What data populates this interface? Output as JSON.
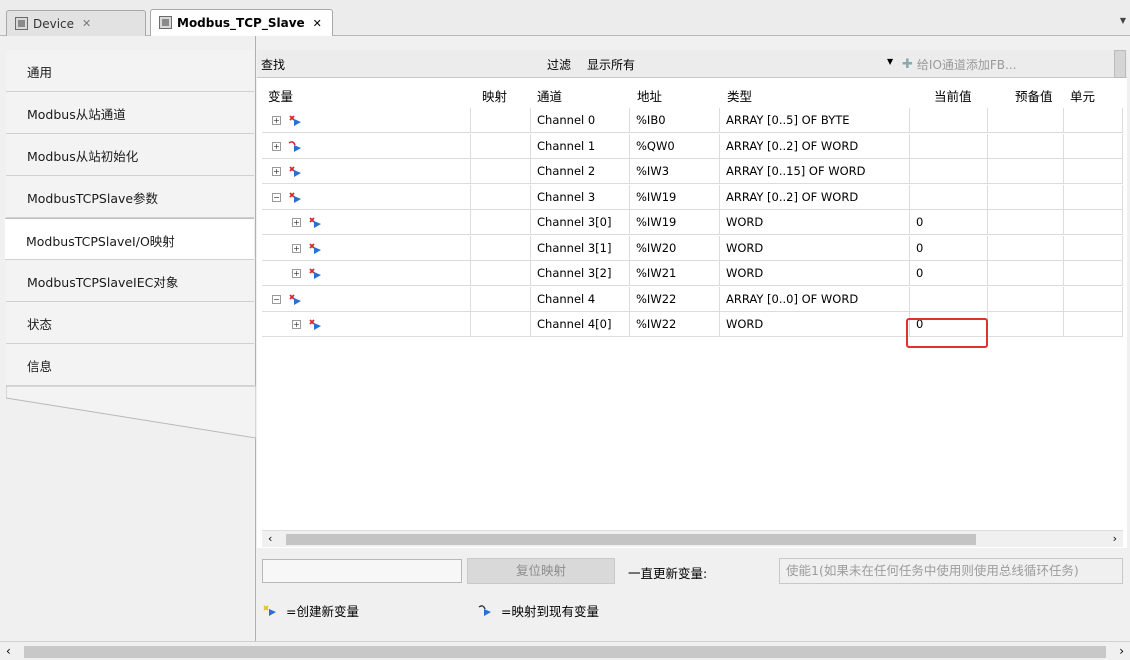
{
  "tabs": [
    {
      "label": "Device",
      "close": "✕",
      "icon": "device-icon"
    },
    {
      "label": "Modbus_TCP_Slave",
      "close": "✕",
      "icon": "device-icon"
    }
  ],
  "nav": {
    "items": [
      {
        "label": "通用"
      },
      {
        "label": "Modbus从站通道"
      },
      {
        "label": "Modbus从站初始化"
      },
      {
        "label": "ModbusTCPSlave参数"
      },
      {
        "label": "ModbusTCPSlaveI/O映射",
        "active": true
      },
      {
        "label": "ModbusTCPSlaveIEC对象"
      },
      {
        "label": "状态"
      },
      {
        "label": "信息"
      }
    ]
  },
  "toolbar": {
    "find_label": "查找",
    "filter_label": "过滤",
    "filter_value": "显示所有",
    "add_fb_label": "给IO通道添加FB..."
  },
  "grid": {
    "headers": {
      "variable": "变量",
      "mapping": "映射",
      "channel": "通道",
      "address": "地址",
      "type": "类型",
      "current": "当前值",
      "preset": "预备值",
      "unit": "单元"
    },
    "rows": [
      {
        "level": 0,
        "expander": "+",
        "icon": "create-variable-icon",
        "channel": "Channel 0",
        "address": "%IB0",
        "type": "ARRAY [0..5] OF BYTE",
        "current": ""
      },
      {
        "level": 0,
        "expander": "+",
        "icon": "map-existing-variable-icon",
        "channel": "Channel 1",
        "address": "%QW0",
        "type": "ARRAY [0..2] OF WORD",
        "current": ""
      },
      {
        "level": 0,
        "expander": "+",
        "icon": "create-variable-icon",
        "channel": "Channel 2",
        "address": "%IW3",
        "type": "ARRAY [0..15] OF WORD",
        "current": ""
      },
      {
        "level": 0,
        "expander": "−",
        "icon": "create-variable-icon",
        "channel": "Channel 3",
        "address": "%IW19",
        "type": "ARRAY [0..2] OF WORD",
        "current": ""
      },
      {
        "level": 1,
        "expander": "+",
        "icon": "create-variable-icon",
        "channel": "Channel 3[0]",
        "address": "%IW19",
        "type": "WORD",
        "current": "0"
      },
      {
        "level": 1,
        "expander": "+",
        "icon": "create-variable-icon",
        "channel": "Channel 3[1]",
        "address": "%IW20",
        "type": "WORD",
        "current": "0"
      },
      {
        "level": 1,
        "expander": "+",
        "icon": "create-variable-icon",
        "channel": "Channel 3[2]",
        "address": "%IW21",
        "type": "WORD",
        "current": "0"
      },
      {
        "level": 0,
        "expander": "−",
        "icon": "create-variable-icon",
        "channel": "Channel 4",
        "address": "%IW22",
        "type": "ARRAY [0..0] OF WORD",
        "current": ""
      },
      {
        "level": 1,
        "expander": "+",
        "icon": "create-variable-icon",
        "channel": "Channel 4[0]",
        "address": "%IW22",
        "type": "WORD",
        "current": "0",
        "highlighted": true
      }
    ]
  },
  "bottom": {
    "reset_mapping": "复位映射",
    "always_update_label": "一直更新变量:",
    "always_update_value": "使能1(如果未在任何任务中使用则使用总线循环任务)"
  },
  "legend": {
    "create_new": "=创建新变量",
    "map_existing": "=映射到现有变量"
  },
  "colors": {
    "highlight": "#e03030",
    "icon_red": "#d42a2a",
    "icon_blue": "#2a6fd4"
  }
}
